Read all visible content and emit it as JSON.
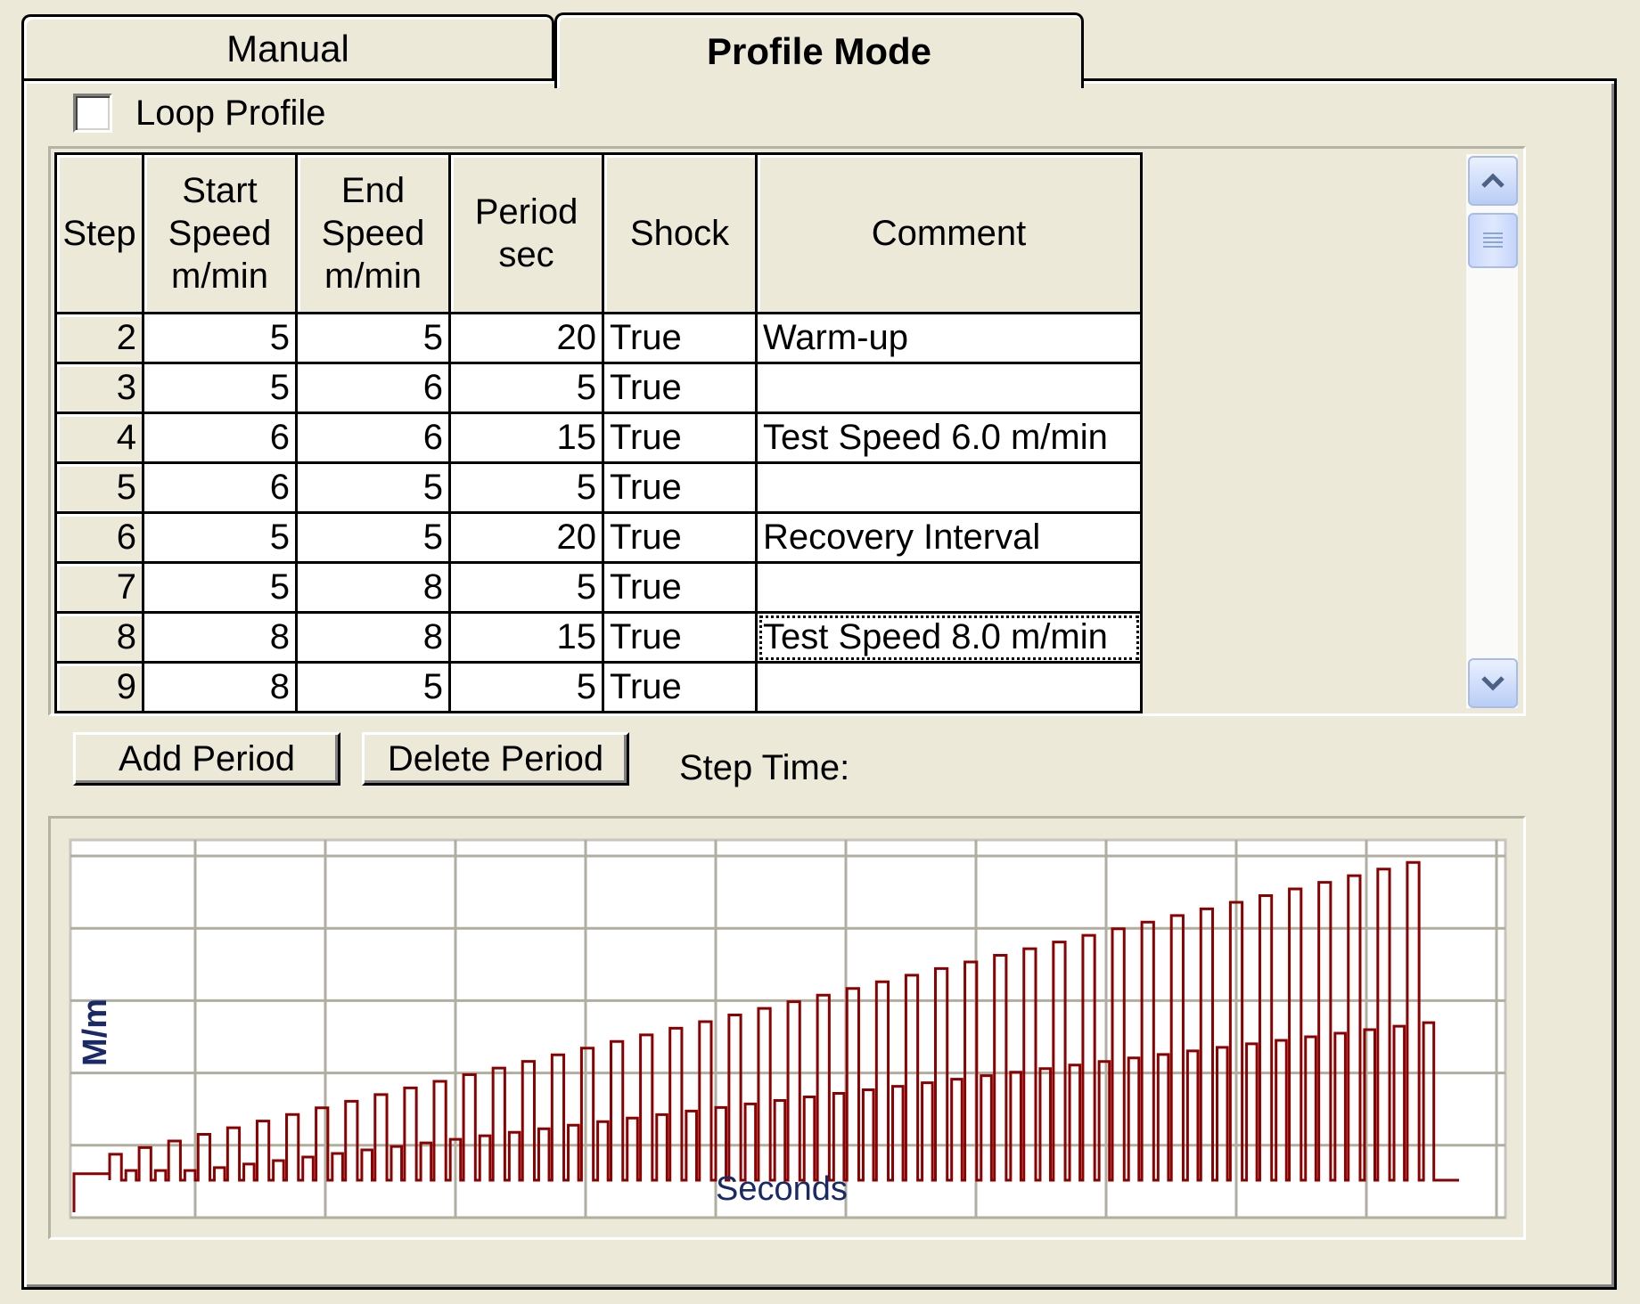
{
  "tabs": [
    {
      "label": "Manual",
      "active": false
    },
    {
      "label": "Profile Mode",
      "active": true
    }
  ],
  "loop_profile": {
    "label": "Loop Profile",
    "checked": false
  },
  "grid": {
    "headers": {
      "step": "Step",
      "start_speed": [
        "Start",
        "Speed",
        "m/min"
      ],
      "end_speed": [
        "End",
        "Speed",
        "m/min"
      ],
      "period": [
        "Period",
        "sec"
      ],
      "shock": "Shock",
      "comment": "Comment"
    },
    "rows": [
      {
        "step": "2",
        "start": "5",
        "end": "5",
        "period": "20",
        "shock": "True",
        "comment": "Warm-up"
      },
      {
        "step": "3",
        "start": "5",
        "end": "6",
        "period": "5",
        "shock": "True",
        "comment": ""
      },
      {
        "step": "4",
        "start": "6",
        "end": "6",
        "period": "15",
        "shock": "True",
        "comment": "Test Speed 6.0 m/min"
      },
      {
        "step": "5",
        "start": "6",
        "end": "5",
        "period": "5",
        "shock": "True",
        "comment": ""
      },
      {
        "step": "6",
        "start": "5",
        "end": "5",
        "period": "20",
        "shock": "True",
        "comment": "Recovery Interval"
      },
      {
        "step": "7",
        "start": "5",
        "end": "8",
        "period": "5",
        "shock": "True",
        "comment": ""
      },
      {
        "step": "8",
        "start": "8",
        "end": "8",
        "period": "15",
        "shock": "True",
        "comment": "Test Speed 8.0 m/min"
      },
      {
        "step": "9",
        "start": "8",
        "end": "5",
        "period": "5",
        "shock": "True",
        "comment": ""
      }
    ],
    "focused_row": 6
  },
  "buttons": {
    "add": "Add Period",
    "delete": "Delete Period"
  },
  "step_time_label": "Step Time:",
  "chart_data": {
    "type": "line",
    "xlabel": "Seconds",
    "ylabel": "M/m",
    "series_color": "#8b0000",
    "pulse_count": 45,
    "high_start": 0.08,
    "high_end": 0.98,
    "low_start": 0.03,
    "low_end": 0.51,
    "grid_rows": 5,
    "grid_cols": 11
  },
  "colors": {
    "background": "#ece9d8",
    "series": "#8b0000",
    "grid": "#b0ae9f"
  }
}
